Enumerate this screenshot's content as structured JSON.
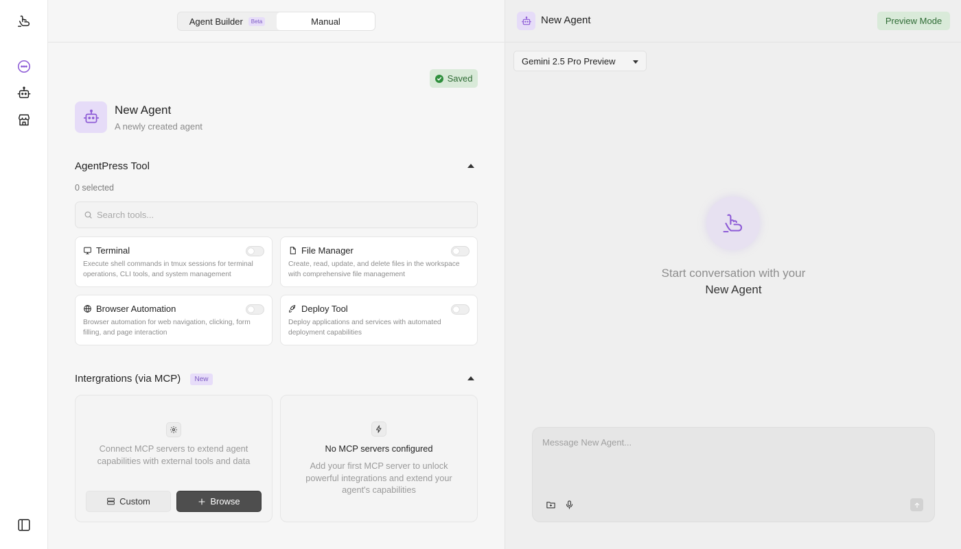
{
  "colors": {
    "accent_purple": "#7c5ac2",
    "avatar_bg": "#e6dcf8",
    "saved_bg": "#d9ead9",
    "saved_text": "#2e6b34",
    "browse_bg": "#4e4e4e"
  },
  "sidebar": {
    "icons": [
      "logo-hand-icon",
      "chat-icon",
      "robot-icon",
      "store-icon",
      "panel-toggle-icon"
    ]
  },
  "builder": {
    "tabs": {
      "builder_label": "Agent Builder",
      "beta_label": "Beta",
      "manual_label": "Manual"
    },
    "saved_label": "Saved",
    "agent": {
      "name": "New Agent",
      "description": "A newly created agent"
    },
    "tools_section": {
      "title": "AgentPress Tool",
      "selected_text": "0 selected",
      "search_placeholder": "Search tools...",
      "tools": [
        {
          "name": "Terminal",
          "icon": "terminal-icon",
          "description": "Execute shell commands in tmux sessions for terminal operations, CLI tools, and system management",
          "enabled": false
        },
        {
          "name": "File Manager",
          "icon": "file-icon",
          "description": "Create, read, update, and delete files in the workspace with comprehensive file management",
          "enabled": false
        },
        {
          "name": "Browser Automation",
          "icon": "globe-icon",
          "description": "Browser automation for web navigation, clicking, form filling, and page interaction",
          "enabled": false
        },
        {
          "name": "Deploy Tool",
          "icon": "rocket-icon",
          "description": "Deploy applications and services with automated deployment capabilities",
          "enabled": false
        }
      ]
    },
    "integrations": {
      "title": "Intergrations (via MCP)",
      "new_badge": "New",
      "connect_text": "Connect MCP servers to extend agent capabilities with external tools and data",
      "custom_label": "Custom",
      "browse_label": "Browse",
      "empty_title": "No MCP servers configured",
      "empty_text": "Add your first MCP server to unlock powerful integrations and extend your agent's capabilities"
    }
  },
  "preview": {
    "title": "New Agent",
    "mode_label": "Preview Mode",
    "model": "Gemini 2.5 Pro Preview",
    "start_line1": "Start conversation with your",
    "start_line2": "New Agent",
    "message_placeholder": "Message New Agent..."
  }
}
